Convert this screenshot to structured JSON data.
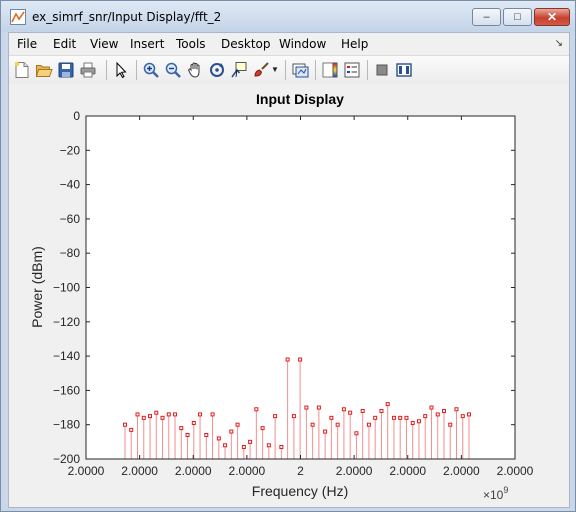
{
  "window": {
    "title": "ex_simrf_snr/Input Display/fft_2",
    "minimize": "–",
    "maximize": "□",
    "close": "✕"
  },
  "menu": [
    "File",
    "Edit",
    "View",
    "Insert",
    "Tools",
    "Desktop",
    "Window",
    "Help"
  ],
  "menu_dock_icon": "dock-arrow-icon",
  "toolbar": [
    "new-figure-icon",
    "open-icon",
    "save-icon",
    "print-icon",
    "pointer-icon",
    "zoom-in-icon",
    "zoom-out-icon",
    "pan-icon",
    "rotate-icon",
    "data-cursor-icon",
    "brush-icon",
    "link-plot-icon",
    "colorbar-icon",
    "legend-icon",
    "hide-plot-tools-icon",
    "show-plot-tools-icon"
  ],
  "colors": {
    "stem": "#f28e8e",
    "marker": "#e41a1a"
  },
  "chart_data": {
    "type": "stem",
    "title": "Input Display",
    "xlabel": "Frequency (Hz)",
    "ylabel": "Power (dBm)",
    "x_exponent": "×10",
    "x_exponent_power": "9",
    "xtick_labels": [
      "2.0000",
      "2.0000",
      "2.0000",
      "2.0000",
      "2",
      "2.0000",
      "2.0000",
      "2.0000",
      "2.0000"
    ],
    "ytick_labels": [
      "0",
      "−20",
      "−40",
      "−60",
      "−80",
      "−100",
      "−120",
      "−140",
      "−160",
      "−180",
      "−200"
    ],
    "ylim": [
      -200,
      0
    ],
    "grid": false,
    "values": [
      -180,
      -183,
      -174,
      -176,
      -175,
      -173,
      -176,
      -174,
      -174,
      -182,
      -186,
      -179,
      -174,
      -186,
      -174,
      -188,
      -192,
      -184,
      -180,
      -193,
      -190,
      -171,
      -182,
      -192,
      -175,
      -193,
      -142,
      -175,
      -142,
      -170,
      -180,
      -170,
      -184,
      -176,
      -180,
      -171,
      -173,
      -185,
      -172,
      -180,
      -176,
      -172,
      -168,
      -176,
      -176,
      -176,
      -179,
      -178,
      -175,
      -170,
      -174,
      -172,
      -180,
      -171,
      -175,
      -174
    ]
  }
}
